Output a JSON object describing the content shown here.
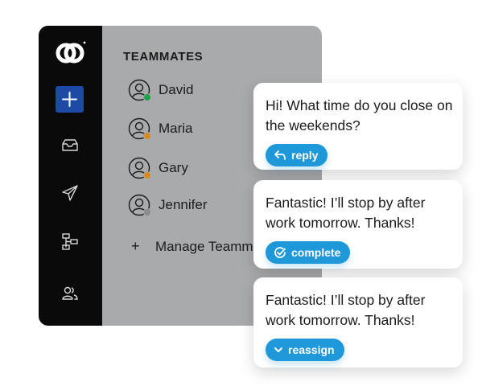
{
  "sidebar": {
    "icons": [
      "logo-icon",
      "plus-icon",
      "inbox-icon",
      "send-icon",
      "workflow-icon",
      "users-icon"
    ]
  },
  "panel": {
    "title": "TEAMMATES",
    "teammates": [
      {
        "name": "David",
        "status_color": "#1fa24a"
      },
      {
        "name": "Maria",
        "status_color": "#d98a1f"
      },
      {
        "name": "Gary",
        "status_color": "#d98a1f"
      },
      {
        "name": "Jennifer",
        "status_color": "#8b8b8b"
      }
    ],
    "manage_label": "Manage Teamm",
    "partial_text": "g"
  },
  "messages": [
    {
      "text": "Hi! What time do you close on the weekends?",
      "action": "reply",
      "action_icon": "reply-icon"
    },
    {
      "text": "Fantastic! I’ll stop by after work tomorrow. Thanks!",
      "action": "complete",
      "action_icon": "check-circle-icon"
    },
    {
      "text": "Fantastic! I’ll stop by after work tomorrow. Thanks!",
      "action": "reassign",
      "action_icon": "chevron-down-icon"
    }
  ],
  "colors": {
    "accent": "#1e98d9",
    "rail": "#0a0a0a",
    "panel": "#a9aaac",
    "add_button": "#1c4aa5"
  }
}
